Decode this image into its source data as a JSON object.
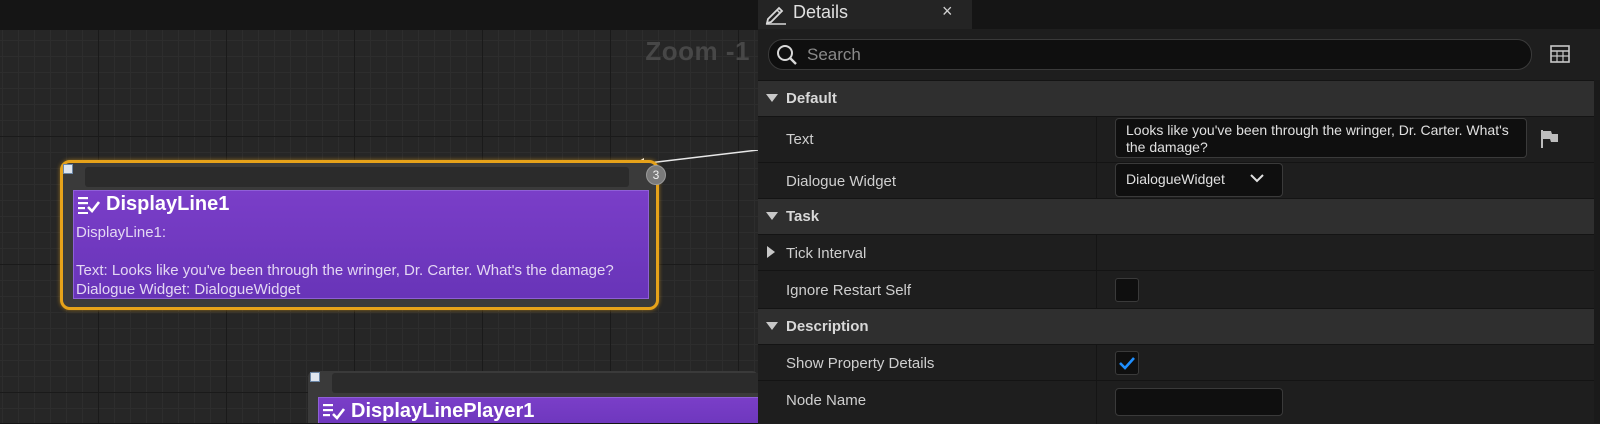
{
  "graph": {
    "zoom_label": "Zoom -1",
    "node1": {
      "title": "DisplayLine1",
      "description": "DisplayLine1:\n\nText: Looks like you've been through the wringer, Dr. Carter. What's the damage?\nDialogue Widget: DialogueWidget",
      "badge": "3",
      "border_color": "#e6a21a",
      "body_color": "#7a3ec8"
    },
    "node2": {
      "title": "DisplayLinePlayer1"
    }
  },
  "details": {
    "tab_title": "Details",
    "tab_close": "×",
    "search": {
      "placeholder": "Search",
      "value": ""
    },
    "categories": [
      {
        "label": "Default"
      },
      {
        "label": "Task"
      },
      {
        "label": "Description"
      }
    ],
    "properties": {
      "text": {
        "label": "Text",
        "value": "Looks like you've been through the wringer, Dr. Carter. What's the damage?"
      },
      "dialogue_widget": {
        "label": "Dialogue Widget",
        "value": "DialogueWidget"
      },
      "tick_interval": {
        "label": "Tick Interval"
      },
      "ignore_restart_self": {
        "label": "Ignore Restart Self",
        "checked": false
      },
      "show_property_details": {
        "label": "Show Property Details",
        "checked": true
      },
      "node_name": {
        "label": "Node Name",
        "value": ""
      }
    },
    "accent_color": "#1f8fff"
  }
}
